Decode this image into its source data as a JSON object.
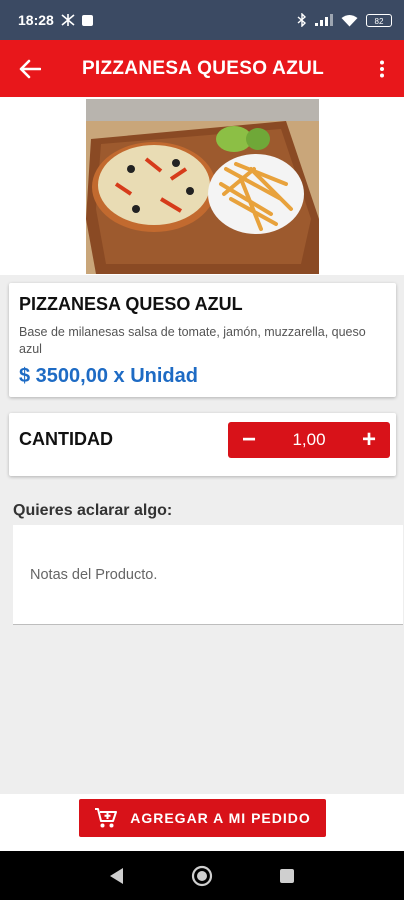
{
  "status_bar": {
    "time": "18:28",
    "battery": "82"
  },
  "app_bar": {
    "title": "PIZZANESA QUESO AZUL"
  },
  "product": {
    "name": "PIZZANESA QUESO AZUL",
    "description": "Base de milanesas salsa de tomate, jamón, muzzarella, queso azul",
    "price": "$ 3500,00 x Unidad"
  },
  "quantity": {
    "label": "CANTIDAD",
    "value": "1,00",
    "minus": "−",
    "plus": "+"
  },
  "notes": {
    "title": "Quieres aclarar algo:",
    "placeholder": "Notas del Producto."
  },
  "bottom": {
    "add_label": "AGREGAR A MI PEDIDO"
  },
  "colors": {
    "primary": "#e8171b",
    "price": "#1e6bc4",
    "status_bar": "#3b4a63"
  },
  "icons": {
    "back": "arrow-back-icon",
    "menu": "more-vertical-icon",
    "cart": "add-cart-icon",
    "nav_back": "nav-back-icon",
    "nav_home": "nav-home-icon",
    "nav_recents": "nav-recents-icon"
  }
}
